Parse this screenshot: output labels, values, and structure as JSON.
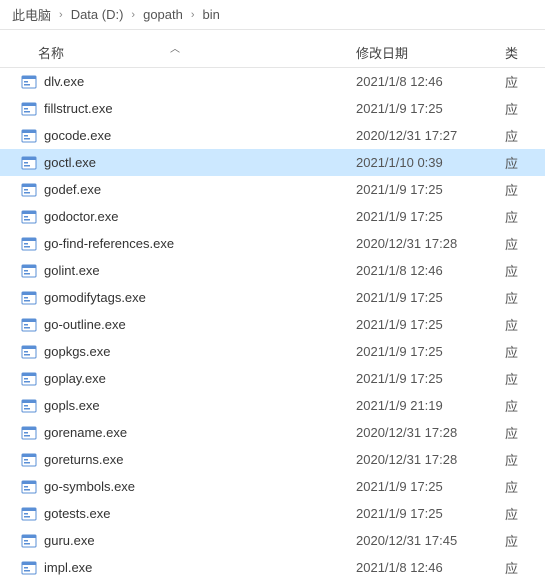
{
  "breadcrumb": {
    "items": [
      "此电脑",
      "Data (D:)",
      "gopath",
      "bin"
    ]
  },
  "headers": {
    "name": "名称",
    "date": "修改日期",
    "type": "类"
  },
  "type_char": "应",
  "files": [
    {
      "name": "dlv.exe",
      "date": "2021/1/8 12:46",
      "selected": false
    },
    {
      "name": "fillstruct.exe",
      "date": "2021/1/9 17:25",
      "selected": false
    },
    {
      "name": "gocode.exe",
      "date": "2020/12/31 17:27",
      "selected": false
    },
    {
      "name": "goctl.exe",
      "date": "2021/1/10 0:39",
      "selected": true
    },
    {
      "name": "godef.exe",
      "date": "2021/1/9 17:25",
      "selected": false
    },
    {
      "name": "godoctor.exe",
      "date": "2021/1/9 17:25",
      "selected": false
    },
    {
      "name": "go-find-references.exe",
      "date": "2020/12/31 17:28",
      "selected": false
    },
    {
      "name": "golint.exe",
      "date": "2021/1/8 12:46",
      "selected": false
    },
    {
      "name": "gomodifytags.exe",
      "date": "2021/1/9 17:25",
      "selected": false
    },
    {
      "name": "go-outline.exe",
      "date": "2021/1/9 17:25",
      "selected": false
    },
    {
      "name": "gopkgs.exe",
      "date": "2021/1/9 17:25",
      "selected": false
    },
    {
      "name": "goplay.exe",
      "date": "2021/1/9 17:25",
      "selected": false
    },
    {
      "name": "gopls.exe",
      "date": "2021/1/9 21:19",
      "selected": false
    },
    {
      "name": "gorename.exe",
      "date": "2020/12/31 17:28",
      "selected": false
    },
    {
      "name": "goreturns.exe",
      "date": "2020/12/31 17:28",
      "selected": false
    },
    {
      "name": "go-symbols.exe",
      "date": "2021/1/9 17:25",
      "selected": false
    },
    {
      "name": "gotests.exe",
      "date": "2021/1/9 17:25",
      "selected": false
    },
    {
      "name": "guru.exe",
      "date": "2020/12/31 17:45",
      "selected": false
    },
    {
      "name": "impl.exe",
      "date": "2021/1/8 12:46",
      "selected": false
    }
  ]
}
